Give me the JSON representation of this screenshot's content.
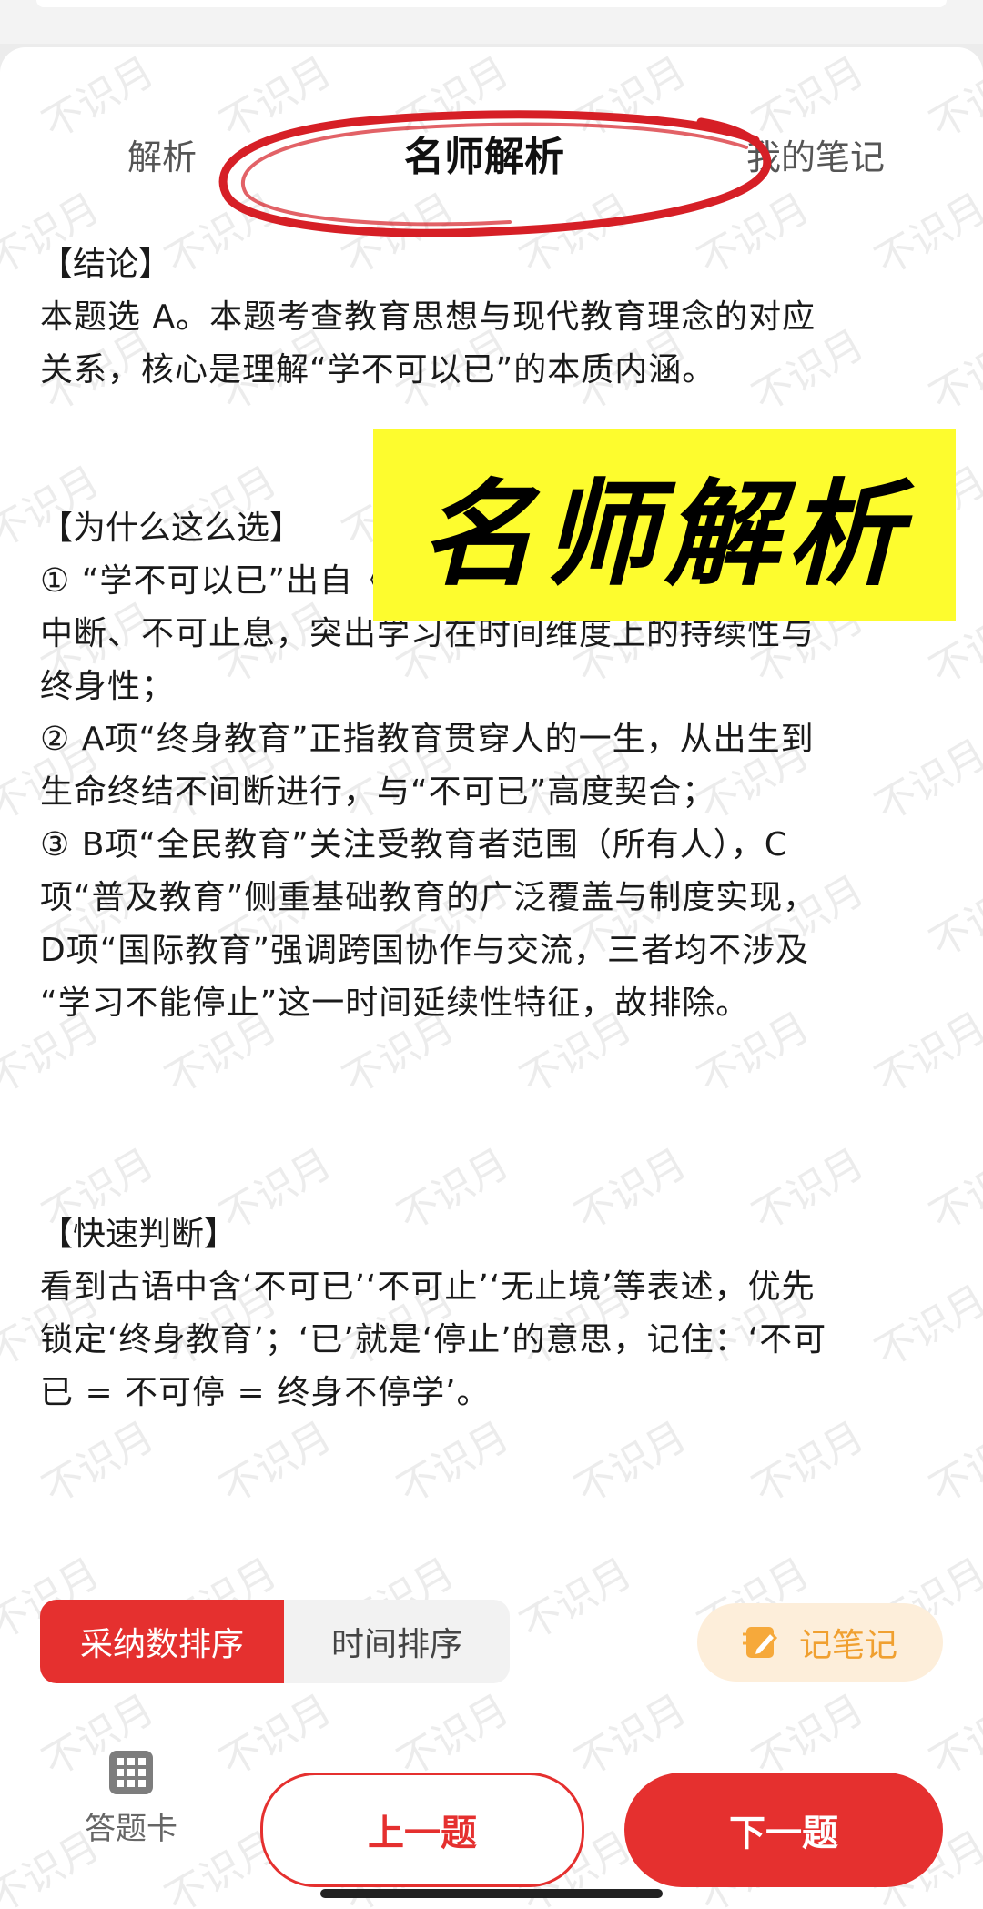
{
  "tabs": [
    {
      "label": "解析"
    },
    {
      "label": "名师解析"
    },
    {
      "label": "我的笔记"
    }
  ],
  "overlay_banner": "名师解析",
  "watermark_text": "不识月",
  "sections": {
    "conclusion": {
      "heading": "【结论】",
      "lines": [
        "本题选 A。本题考查教育思想与现代教育理念的对应",
        "关系，核心是理解“学不可以已”的本质内涵。"
      ]
    },
    "why": {
      "heading": "【为什么这么选】",
      "lines": [
        "① “学不可以已”出自《荀子·劝学》，强调学习不可",
        "中断、不可止息，突出学习在时间维度上的持续性与",
        "终身性；",
        "② A项“终身教育”正指教育贯穿人的一生，从出生到",
        "生命终结不间断进行，与“不可已”高度契合；",
        "③ B项“全民教育”关注受教育者范围（所有人），C",
        "项“普及教育”侧重基础教育的广泛覆盖与制度实现，",
        "D项“国际教育”强调跨国协作与交流，三者均不涉及",
        "“学习不能停止”这一时间延续性特征，故排除。"
      ]
    },
    "quick": {
      "heading": "【快速判断】",
      "lines": [
        "看到古语中含‘不可已’‘不可止’‘无止境’等表述，优先",
        "锁定‘终身教育’；‘已’就是‘停止’的意思，记住：‘不可",
        "已 = 不可停 = 终身不停学’。"
      ]
    }
  },
  "sort": {
    "adopt_label": "采纳数排序",
    "time_label": "时间排序"
  },
  "note_button": "记笔记",
  "bottom": {
    "answer_card": "答题卡",
    "prev": "上一题",
    "next": "下一题"
  },
  "colors": {
    "accent": "#e5302f",
    "banner": "#fdfc2e",
    "note": "#f0a030"
  }
}
